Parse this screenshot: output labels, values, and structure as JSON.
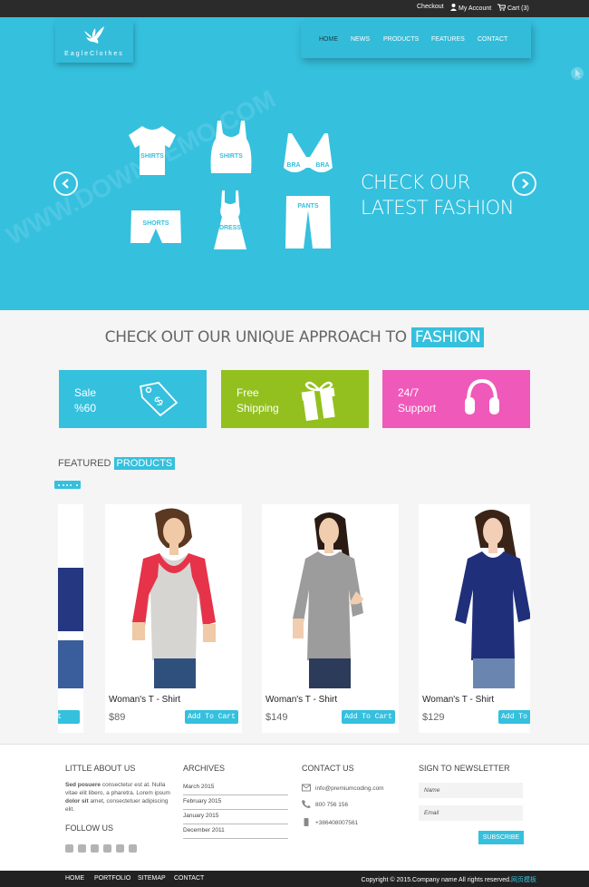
{
  "topbar": {
    "checkout": "Checkout",
    "my_account": "My Account",
    "cart": "Cart (3)"
  },
  "brand": {
    "logo_text": "EagleClothes"
  },
  "nav": [
    {
      "label": "HOME",
      "active": true
    },
    {
      "label": "NEWS"
    },
    {
      "label": "PRODUCTS"
    },
    {
      "label": "FEATURES"
    },
    {
      "label": "CONTACT"
    }
  ],
  "hero": {
    "title_line1": "CHECK OUR",
    "title_line2": "LATEST FASHION",
    "garments": [
      "SHIRTS",
      "SHIRTS",
      "BRA",
      "BRA",
      "SHORTS",
      "DRESS",
      "PANTS"
    ]
  },
  "tagline": {
    "text": "CHECK OUT OUR UNIQUE APPROACH TO ",
    "highlight": "FASHION"
  },
  "features": [
    {
      "line1": "Sale",
      "line2": "%60",
      "color": "#35c0de",
      "icon": "price-tag-icon"
    },
    {
      "line1": "Free",
      "line2": "Shipping",
      "color": "#93c01f",
      "icon": "gift-icon"
    },
    {
      "line1": "24/7",
      "line2": "Support",
      "color": "#ef59b9",
      "icon": "headphones-icon"
    }
  ],
  "featured": {
    "title": "FEATURED ",
    "highlight": "PRODUCTS"
  },
  "products": [
    {
      "name": "Woman's T - Shirt",
      "price": "$89",
      "button": "Add To Cart"
    },
    {
      "name": "Woman's T - Shirt",
      "price": "$149",
      "button": "Add To Cart"
    },
    {
      "name": "Woman's T - Shirt",
      "price": "$129",
      "button": "Add To Cart"
    }
  ],
  "partial_left_button": "Cart",
  "footer": {
    "about_title": "LITTLE ABOUT US",
    "about_bold1": "Sed posuere",
    "about_text1": " consectetur est at. Nulla vitae elit libero, a pharetra. Lorem ipsum ",
    "about_bold2": "dolor sit",
    "about_text2": " amet, consectetuer adipiscing elit.",
    "follow_title": "FOLLOW US",
    "archives_title": "ARCHIVES",
    "archives": [
      "March 2015",
      "February 2015",
      "January 2015",
      "December 2011"
    ],
    "contact_title": "CONTACT US",
    "contact_email": "info@premiumcoding.com",
    "contact_phone": "800 756 156",
    "contact_mobile": "+386408007561",
    "newsletter_title": "SIGN TO NEWSLETTER",
    "name_placeholder": "Name",
    "email_placeholder": "Email",
    "subscribe": "SUBSCRIBE"
  },
  "bottom_nav": [
    "HOME",
    "PORTFOLIO",
    "SITEMAP",
    "CONTACT"
  ],
  "copyright": "Copyright © 2015.Company name All rights reserved.",
  "copyright_cn": "网页模板"
}
